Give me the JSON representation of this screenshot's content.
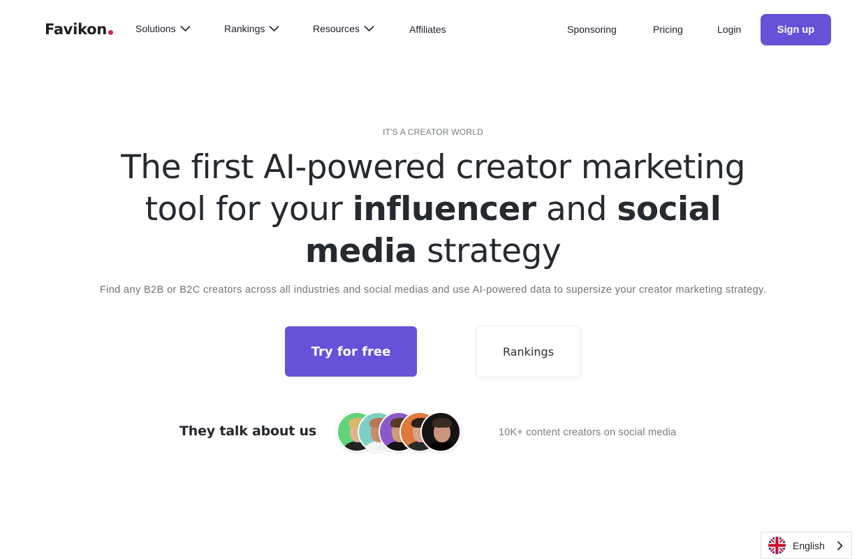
{
  "header": {
    "logo": "Favikon",
    "nav": [
      {
        "label": "Solutions",
        "has_dropdown": true
      },
      {
        "label": "Rankings",
        "has_dropdown": true
      },
      {
        "label": "Resources",
        "has_dropdown": true
      },
      {
        "label": "Affiliates",
        "has_dropdown": false
      }
    ],
    "right_nav": [
      {
        "label": "Sponsoring"
      },
      {
        "label": "Pricing"
      },
      {
        "label": "Login"
      }
    ],
    "signup_label": "Sign up"
  },
  "hero": {
    "eyebrow": "IT'S A CREATOR WORLD",
    "headline": {
      "part1": "The first AI-powered creator marketing tool for your ",
      "bold1": "influencer",
      "part2": " and ",
      "bold2": "social media",
      "part3": " strategy"
    },
    "subtext": "Find any B2B or B2C creators across all industries and social medias and use AI-powered data to supersize your creator marketing strategy.",
    "primary_cta": "Try for free",
    "secondary_cta": "Rankings"
  },
  "social_proof": {
    "title": "They talk about us",
    "avatars": [
      {
        "name": "creator-1",
        "bg": "#5fd47a"
      },
      {
        "name": "creator-2",
        "bg": "#7fcfc6"
      },
      {
        "name": "creator-3",
        "bg": "#8a5bc7"
      },
      {
        "name": "creator-4",
        "bg": "#e07a3a"
      },
      {
        "name": "creator-5",
        "bg": "#141414"
      }
    ],
    "stat": "10K+ content creators on social media"
  },
  "language": {
    "current": "English",
    "flag": "uk-flag-icon"
  },
  "colors": {
    "brand": "#6652d8",
    "logo_dot": "#d6246e",
    "text_dark": "#23282d",
    "text_muted": "#747a80"
  }
}
